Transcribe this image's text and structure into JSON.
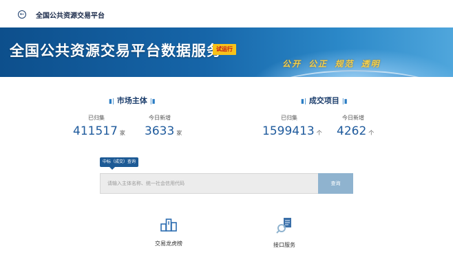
{
  "topbar": {
    "title": "全国公共资源交易平台"
  },
  "banner": {
    "title": "全国公共资源交易平台数据服务",
    "badge": "试运行",
    "slogan": "公开 公正 规范 透明"
  },
  "stats": {
    "market": {
      "heading": "市场主体",
      "items": [
        {
          "label": "已归集",
          "value": "411517",
          "unit": "家"
        },
        {
          "label": "今日新增",
          "value": "3633",
          "unit": "家"
        }
      ]
    },
    "deals": {
      "heading": "成交项目",
      "items": [
        {
          "label": "已归集",
          "value": "1599413",
          "unit": "个"
        },
        {
          "label": "今日新增",
          "value": "4262",
          "unit": "个"
        }
      ]
    }
  },
  "search": {
    "tag": "中标（成交）查询",
    "placeholder": "请输入主体名称、统一社会信用代码",
    "button": "查询"
  },
  "shortcuts": [
    {
      "label": "交易龙虎榜",
      "icon": "ranking-podium-icon"
    },
    {
      "label": "接口服务",
      "icon": "api-search-icon"
    }
  ],
  "colors": {
    "brand_blue": "#1a3c6b",
    "value_blue": "#1e5a9c",
    "badge_yellow": "#f7c21a",
    "search_button": "#8fb3cf"
  }
}
